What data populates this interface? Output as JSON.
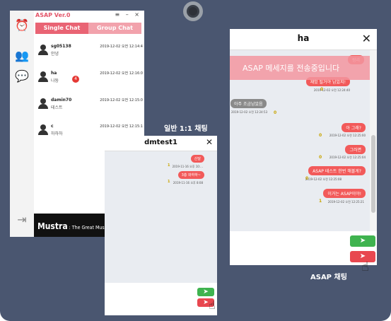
{
  "app": {
    "title": "ASAP Ver.0",
    "window_controls": "≡ – ×",
    "tabs": [
      {
        "label": "Single Chat"
      },
      {
        "label": "Group Chat"
      }
    ],
    "contacts": [
      {
        "name": "sg05138",
        "status": "안녕",
        "time": "2019-12-02 오전 12:14:4"
      },
      {
        "name": "ha",
        "status": "나둥",
        "time": "2019-12-02 오전 12:16:0",
        "badge": "4"
      },
      {
        "name": "damin70",
        "status": "테스트",
        "time": "2019-12-02 오전 12:15:0"
      },
      {
        "name": "c",
        "status": "하하하",
        "time": "2019-12-02 오전 12:15:1"
      }
    ],
    "banner_big": "Mustra",
    "banner_small": " : The Great Music Predic"
  },
  "captions": {
    "dm": "일반 1:1 채팅",
    "asap": "ASAP 채팅"
  },
  "dm_chat": {
    "title": "dmtest1",
    "close": "✕",
    "messages": [
      {
        "text": "산달",
        "stamp": "2019-11-16 오후 10:...",
        "read": "1"
      },
      {
        "text": "3층 와하하~",
        "stamp": "2019-11-16 오후 8:08",
        "read": "1"
      }
    ]
  },
  "ha_chat": {
    "title": "ha",
    "close": "✕",
    "asap_notice": "ASAP 메세지를 전송중입니다",
    "messages": [
      {
        "text": "링리",
        "stamp": "",
        "read": "",
        "side": "right"
      },
      {
        "text": "재밌 될거야 남았지!",
        "stamp": "2019-12-02 오전 12:24:40",
        "read": "0",
        "side": "right"
      },
      {
        "text": "아주 조금남았음",
        "stamp": "2019-12-02 오전 12:24:53",
        "read": "0",
        "side": "left"
      },
      {
        "text": "아 그래?",
        "stamp": "2019-12-02 오전 12:25:00",
        "read": "0",
        "side": "right"
      },
      {
        "text": "그러면",
        "stamp": "2019-12-02 오전 12:25:04",
        "read": "0",
        "side": "right"
      },
      {
        "text": "ASAP 테스트 한번 해볼게?",
        "stamp": "2019-12-02 오전 12:25:08",
        "read": "0",
        "side": "right"
      },
      {
        "text": "이거는 ASAP이야!",
        "stamp": "2019-12-02 오전 12:25:21",
        "read": "1",
        "side": "right"
      }
    ]
  },
  "colors": {
    "frame": "#4a5670",
    "accent": "#e96474",
    "send_normal": "#3fb34f",
    "send_asap": "#e8474f"
  }
}
